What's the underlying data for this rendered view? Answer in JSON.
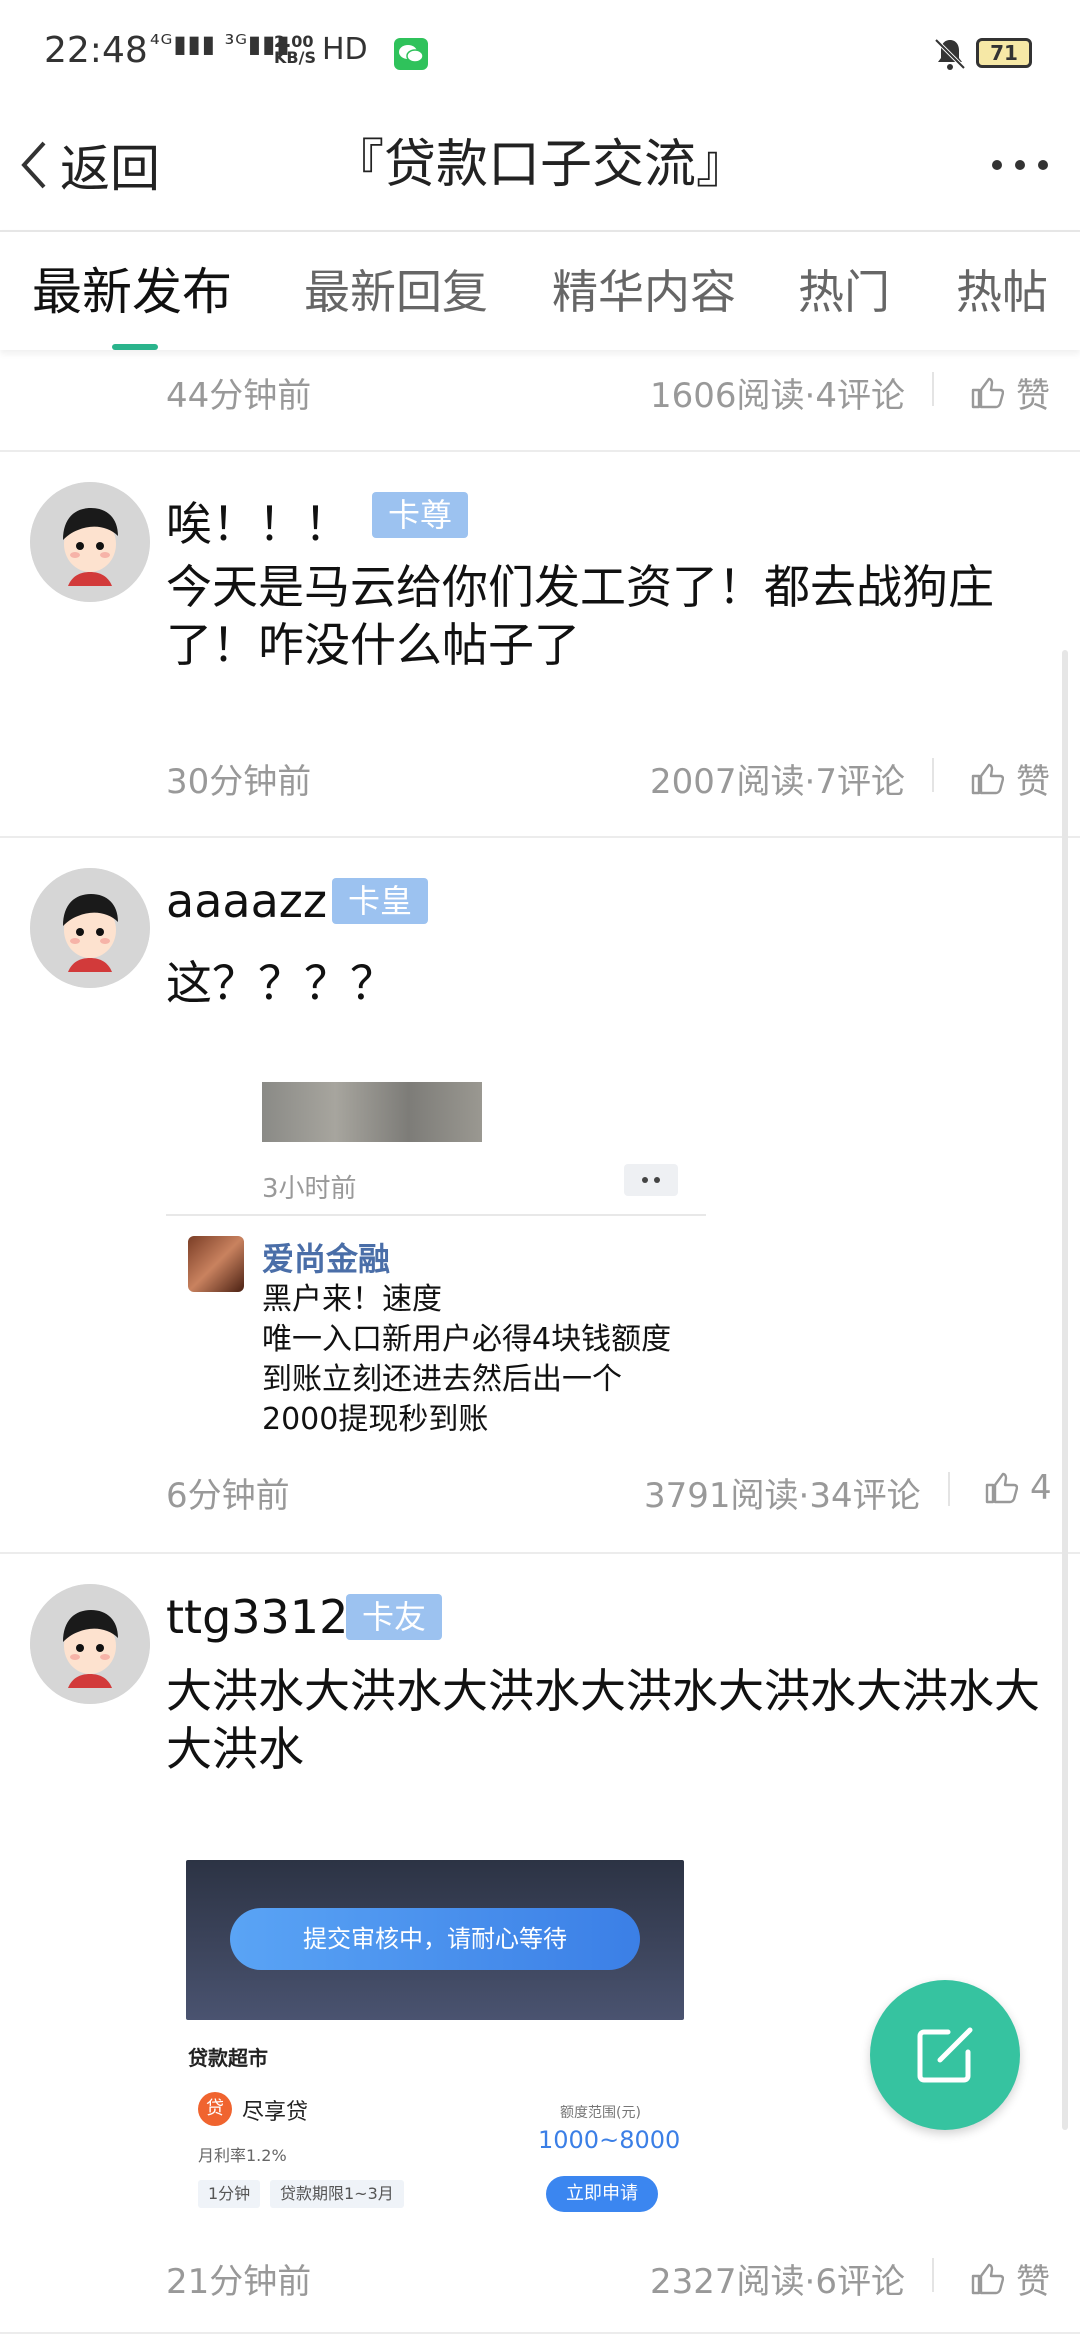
{
  "status_bar": {
    "time": "22:48",
    "network": "⁴ᴳ▮▮▮ ³ᴳ▮▮▮",
    "speed_value": "2.00",
    "speed_unit": "KB/S",
    "hd": "HD",
    "battery": "71"
  },
  "header": {
    "back_label": "返回",
    "title": "『贷款口子交流』"
  },
  "tabs": [
    {
      "label": "最新发布",
      "active": true
    },
    {
      "label": "最新回复",
      "active": false
    },
    {
      "label": "精华内容",
      "active": false
    },
    {
      "label": "热门",
      "active": false
    },
    {
      "label": "热帖",
      "active": false
    }
  ],
  "accent_color": "#2ab48c",
  "posts": [
    {
      "time": "44分钟前",
      "stats": "1606阅读·4评论",
      "like": "赞"
    },
    {
      "username": "唉！！！",
      "badge": "卡尊",
      "content": "今天是马云给你们发工资了！都去战狗庄了！咋没什么帖子了",
      "time": "30分钟前",
      "stats": "2007阅读·7评论",
      "like": "赞"
    },
    {
      "username": "aaaazz",
      "badge": "卡皇",
      "content": "这？？？？",
      "shared": {
        "time": "3小时前",
        "ad_name": "爱尚金融",
        "ad_text": "黑户来！速度\n唯一入口新用户必得4块钱额度到账立刻还进去然后出一个2000提现秒到账"
      },
      "time": "6分钟前",
      "stats": "3791阅读·34评论",
      "like": "4"
    },
    {
      "username": "ttg3312",
      "badge": "卡友",
      "content": "大洪水大洪水大洪水大洪水大洪水大洪水大大洪水",
      "loan_image": {
        "banner": "提交审核中，请耐心等待",
        "market_title": "贷款超市",
        "loan_icon": "贷",
        "loan_name": "尽享贷",
        "rate": "月利率1.2%",
        "tag1": "1分钟",
        "tag2": "贷款期限1~3月",
        "range_label": "额度范围(元)",
        "range_value": "1000~8000",
        "apply": "立即申请"
      },
      "time": "21分钟前",
      "stats": "2327阅读·6评论",
      "like": "赞"
    }
  ]
}
